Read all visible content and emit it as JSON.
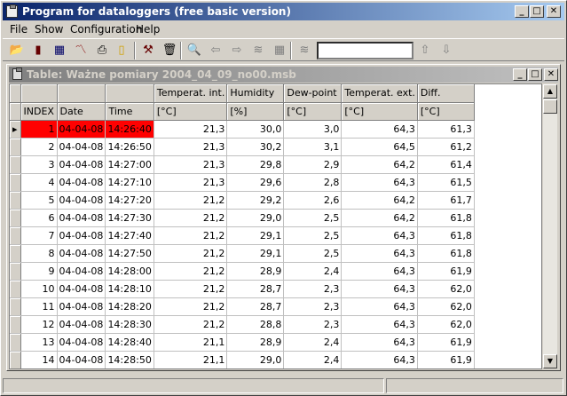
{
  "app": {
    "title": "Program for dataloggers (free basic version)"
  },
  "menu": [
    "File",
    "Show",
    "Configuration",
    "Help"
  ],
  "toolbar": {
    "search_value": ""
  },
  "child": {
    "title": "Table:  Ważne pomiary   2004_04_09_no00.msb"
  },
  "table": {
    "headers_top": [
      "",
      "",
      "",
      "Temperat. int.",
      "Humidity",
      "Dew-point",
      "Temperat. ext.",
      "Diff."
    ],
    "headers_bottom": [
      "INDEX",
      "Date",
      "Time",
      "[°C]",
      "[%]",
      "[°C]",
      "[°C]",
      "[°C]"
    ],
    "rows": [
      [
        "1",
        "04-04-08",
        "14:26:40",
        "21,3",
        "30,0",
        "3,0",
        "64,3",
        "61,3"
      ],
      [
        "2",
        "04-04-08",
        "14:26:50",
        "21,3",
        "30,2",
        "3,1",
        "64,5",
        "61,2"
      ],
      [
        "3",
        "04-04-08",
        "14:27:00",
        "21,3",
        "29,8",
        "2,9",
        "64,2",
        "61,4"
      ],
      [
        "4",
        "04-04-08",
        "14:27:10",
        "21,3",
        "29,6",
        "2,8",
        "64,3",
        "61,5"
      ],
      [
        "5",
        "04-04-08",
        "14:27:20",
        "21,2",
        "29,2",
        "2,6",
        "64,2",
        "61,7"
      ],
      [
        "6",
        "04-04-08",
        "14:27:30",
        "21,2",
        "29,0",
        "2,5",
        "64,2",
        "61,8"
      ],
      [
        "7",
        "04-04-08",
        "14:27:40",
        "21,2",
        "29,1",
        "2,5",
        "64,3",
        "61,8"
      ],
      [
        "8",
        "04-04-08",
        "14:27:50",
        "21,2",
        "29,1",
        "2,5",
        "64,3",
        "61,8"
      ],
      [
        "9",
        "04-04-08",
        "14:28:00",
        "21,2",
        "28,9",
        "2,4",
        "64,3",
        "61,9"
      ],
      [
        "10",
        "04-04-08",
        "14:28:10",
        "21,2",
        "28,7",
        "2,3",
        "64,3",
        "62,0"
      ],
      [
        "11",
        "04-04-08",
        "14:28:20",
        "21,2",
        "28,7",
        "2,3",
        "64,3",
        "62,0"
      ],
      [
        "12",
        "04-04-08",
        "14:28:30",
        "21,2",
        "28,8",
        "2,3",
        "64,3",
        "62,0"
      ],
      [
        "13",
        "04-04-08",
        "14:28:40",
        "21,1",
        "28,9",
        "2,4",
        "64,3",
        "61,9"
      ],
      [
        "14",
        "04-04-08",
        "14:28:50",
        "21,1",
        "29,0",
        "2,4",
        "64,3",
        "61,9"
      ]
    ]
  },
  "selected_row": 0,
  "colors": {
    "title_active": "#0a246a",
    "title_inactive": "#808080",
    "selection": "#ff0000"
  }
}
